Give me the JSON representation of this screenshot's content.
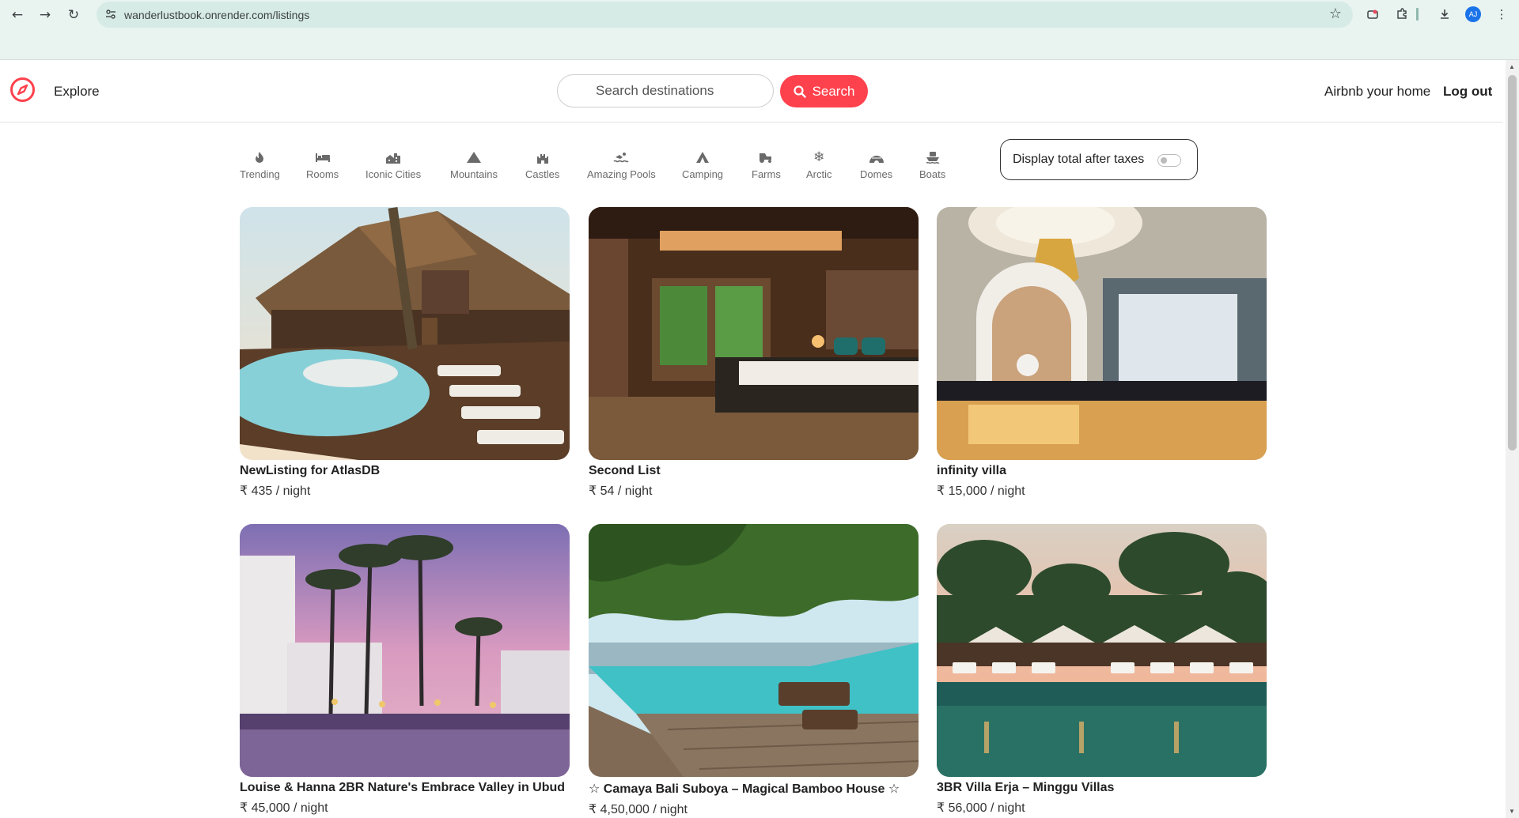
{
  "browser": {
    "back_icon": "arrow-left-icon",
    "forward_icon": "arrow-right-icon",
    "reload_icon": "reload-icon",
    "url": "wanderlustbook.onrender.com/listings",
    "avatar_initials": "AJ"
  },
  "navbar": {
    "explore_label": "Explore",
    "search_placeholder": "Search destinations",
    "search_button": "Search",
    "host_label": "Airbnb your home",
    "logout_label": "Log out",
    "brand_color": "#fe424d"
  },
  "filters": [
    {
      "label": "Trending",
      "icon": "fire-icon"
    },
    {
      "label": "Rooms",
      "icon": "bed-icon"
    },
    {
      "label": "Iconic Cities",
      "icon": "city-icon"
    },
    {
      "label": "Mountains",
      "icon": "mountain-icon"
    },
    {
      "label": "Castles",
      "icon": "castle-icon"
    },
    {
      "label": "Amazing Pools",
      "icon": "swimmer-icon"
    },
    {
      "label": "Camping",
      "icon": "tent-icon"
    },
    {
      "label": "Farms",
      "icon": "tractor-icon"
    },
    {
      "label": "Arctic",
      "icon": "snowflake-icon"
    },
    {
      "label": "Domes",
      "icon": "igloo-icon"
    },
    {
      "label": "Boats",
      "icon": "ship-icon"
    }
  ],
  "tax_toggle": {
    "label": "Display total after taxes",
    "enabled": false
  },
  "listings": [
    {
      "title": "NewListing for AtlasDB",
      "price": "₹ 435 / night"
    },
    {
      "title": "Second List",
      "price": "₹ 54 / night"
    },
    {
      "title": "infinity villa",
      "price": "₹ 15,000 / night"
    },
    {
      "title": "Louise & Hanna 2BR Nature's Embrace Valley in Ubud",
      "price": "₹ 45,000 / night"
    },
    {
      "title": "☆ Camaya Bali Suboya – Magical Bamboo House ☆",
      "price": "₹ 4,50,000 / night"
    },
    {
      "title": "3BR Villa Erja – Minggu Villas",
      "price": "₹ 56,000 / night"
    }
  ]
}
